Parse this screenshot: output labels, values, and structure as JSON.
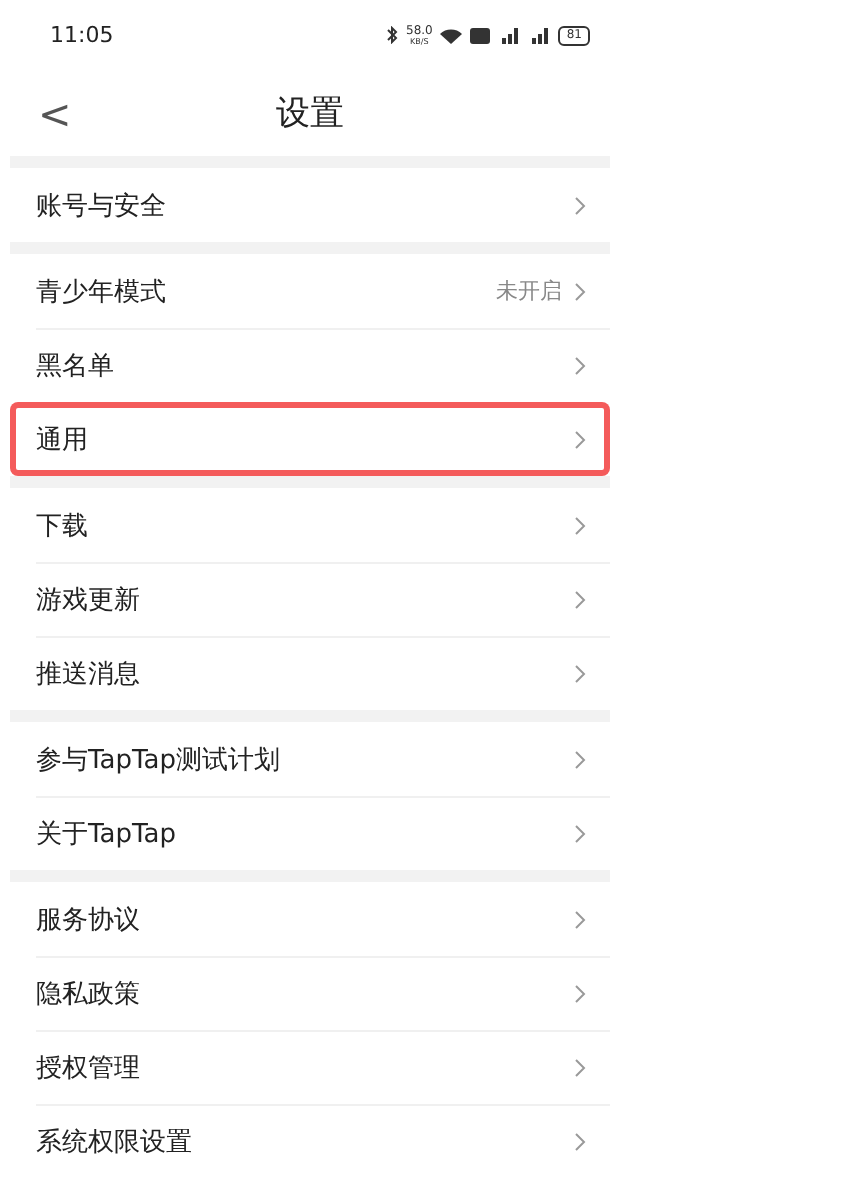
{
  "status_bar": {
    "time": "11:05",
    "speed": "58.0",
    "speed_unit": "KB/S",
    "battery": "81"
  },
  "header": {
    "back": "<",
    "title": "设置"
  },
  "groups": [
    {
      "items": [
        {
          "label": "账号与安全",
          "value": null,
          "highlighted": false
        }
      ]
    },
    {
      "items": [
        {
          "label": "青少年模式",
          "value": "未开启",
          "highlighted": false
        },
        {
          "label": "黑名单",
          "value": null,
          "highlighted": false
        },
        {
          "label": "通用",
          "value": null,
          "highlighted": true
        }
      ]
    },
    {
      "items": [
        {
          "label": "下载",
          "value": null,
          "highlighted": false
        },
        {
          "label": "游戏更新",
          "value": null,
          "highlighted": false
        },
        {
          "label": "推送消息",
          "value": null,
          "highlighted": false
        }
      ]
    },
    {
      "items": [
        {
          "label": "参与TapTap测试计划",
          "value": null,
          "highlighted": false
        },
        {
          "label": "关于TapTap",
          "value": null,
          "highlighted": false
        }
      ]
    },
    {
      "items": [
        {
          "label": "服务协议",
          "value": null,
          "highlighted": false
        },
        {
          "label": "隐私政策",
          "value": null,
          "highlighted": false
        },
        {
          "label": "授权管理",
          "value": null,
          "highlighted": false
        },
        {
          "label": "系统权限设置",
          "value": null,
          "highlighted": false
        }
      ]
    }
  ]
}
